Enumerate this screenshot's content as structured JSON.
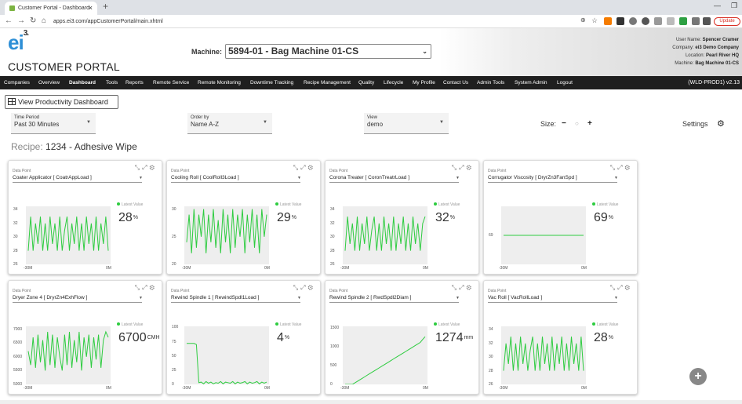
{
  "browser": {
    "tab_title": "Customer Portal - Dashboard",
    "url": "apps.ei3.com/appCustomerPortal/main.xhtml",
    "update_label": "Update"
  },
  "header": {
    "logo": "ei",
    "logo_sup": "3.",
    "portal_title": "CUSTOMER PORTAL",
    "machine_label": "Machine:",
    "machine_value": "5894-01 - Bag Machine 01-CS",
    "user_name_label": "User Name:",
    "user_name": "Spencer Cramer",
    "company_label": "Company:",
    "company": "ei3 Demo Company",
    "location_label": "Location:",
    "location": "Pearl River HQ",
    "machine_info_label": "Machine:",
    "machine_info": "Bag Machine 01-CS"
  },
  "menu": {
    "items": [
      "Companies",
      "Overview",
      "Dashboard",
      "Tools",
      "Reports",
      "Remote Service",
      "Remote Monitoring",
      "Downtime Tracking",
      "Recipe Management",
      "Quality",
      "Lifecycle",
      "My Profile",
      "Contact Us",
      "Admin Tools",
      "System Admin",
      "Logout"
    ],
    "active": "Dashboard",
    "env": "(WLD-PROD1) v2.13"
  },
  "toolbar": {
    "view_productivity": "View Productivity Dashboard",
    "time_period_label": "Time Period",
    "time_period_value": "Past 30 Minutes",
    "order_by_label": "Order by",
    "order_by_value": "Name A-Z",
    "view_label": "View",
    "view_value": "demo",
    "size_label": "Size:",
    "size_minus": "−",
    "size_plus": "+",
    "settings_label": "Settings"
  },
  "recipe": {
    "label": "Recipe:",
    "value": "1234 - Adhesive Wipe"
  },
  "cards": [
    {
      "dp_label": "Data Point",
      "dp_value": "Coater Applicator [ CoatrAppLoad ]",
      "latest_label": "Latest Value",
      "value": "28",
      "unit": "%"
    },
    {
      "dp_label": "Data Point",
      "dp_value": "Cooling Roll [ CoolRoll3Load ]",
      "latest_label": "Latest Value",
      "value": "29",
      "unit": "%"
    },
    {
      "dp_label": "Data Point",
      "dp_value": "Corona Treater [ CoronTreatrLoad ]",
      "latest_label": "Latest Value",
      "value": "32",
      "unit": "%"
    },
    {
      "dp_label": "Data Point",
      "dp_value": "Corrugator Viscosity [ DryrZn3FanSpd ]",
      "latest_label": "Latest Value",
      "value": "69",
      "unit": "%"
    },
    {
      "dp_label": "Data Point",
      "dp_value": "Dryer Zone 4 [ DryrZn4ExhFlow ]",
      "latest_label": "Latest Value",
      "value": "6700",
      "unit": "CMH"
    },
    {
      "dp_label": "Data Point",
      "dp_value": "Rewind Spindle 1 [ RewindSpdl1Load ]",
      "latest_label": "Latest Value",
      "value": "4",
      "unit": "%"
    },
    {
      "dp_label": "Data Point",
      "dp_value": "Rewind Spindle 2 [ RwdSpdl2Diam ]",
      "latest_label": "Latest Value",
      "value": "1274",
      "unit": "mm"
    },
    {
      "dp_label": "Data Point",
      "dp_value": "Vac Roll [ VacRollLoad ]",
      "latest_label": "Latest Value",
      "value": "28",
      "unit": "%"
    }
  ],
  "chart_data": [
    {
      "type": "line",
      "x_ticks": [
        "-30M",
        "0M"
      ],
      "y_ticks": [
        26,
        28,
        30,
        32,
        34
      ],
      "ylim": [
        26,
        34.5
      ],
      "color": "#2ecc40",
      "values": [
        28,
        33,
        28,
        32,
        29,
        33,
        28,
        32,
        28,
        33,
        29,
        32,
        28,
        33,
        28,
        31,
        33,
        28,
        32,
        29,
        33,
        28,
        32,
        28,
        33,
        29,
        32,
        28,
        33,
        28,
        32,
        29,
        33,
        28
      ]
    },
    {
      "type": "line",
      "x_ticks": [
        "-30M",
        "0M"
      ],
      "y_ticks": [
        20,
        25,
        30
      ],
      "ylim": [
        20,
        30.5
      ],
      "color": "#2ecc40",
      "values": [
        24,
        29,
        22,
        30,
        23,
        29,
        25,
        30,
        22,
        29,
        24,
        30,
        23,
        28,
        22,
        30,
        24,
        29,
        22,
        30,
        23,
        29,
        25,
        30,
        22,
        29,
        24,
        30,
        23,
        29,
        22,
        30,
        25,
        29
      ]
    },
    {
      "type": "line",
      "x_ticks": [
        "-30M",
        "0M"
      ],
      "y_ticks": [
        26,
        28,
        30,
        32,
        34
      ],
      "ylim": [
        26,
        34.5
      ],
      "color": "#2ecc40",
      "values": [
        28,
        33,
        29,
        32,
        28,
        33,
        28,
        32,
        29,
        33,
        28,
        31,
        33,
        28,
        32,
        28,
        33,
        29,
        32,
        28,
        33,
        28,
        32,
        29,
        33,
        28,
        32,
        28,
        33,
        29,
        32,
        28,
        32,
        33
      ]
    },
    {
      "type": "line",
      "x_ticks": [
        "-30M",
        "0M"
      ],
      "y_ticks": [
        69
      ],
      "ylim": [
        63,
        75
      ],
      "color": "#2ecc40",
      "values": [
        69,
        69,
        69,
        69,
        69,
        69,
        69,
        69,
        69,
        69,
        69,
        69,
        69,
        69,
        69,
        69,
        69,
        69,
        69,
        69,
        69,
        69,
        69,
        69,
        69,
        69,
        69,
        69,
        69,
        69,
        69,
        69,
        69,
        69
      ]
    },
    {
      "type": "line",
      "x_ticks": [
        "-30M",
        "0M"
      ],
      "y_ticks": [
        5000,
        5500,
        6000,
        6500,
        7000
      ],
      "ylim": [
        5000,
        7100
      ],
      "color": "#2ecc40",
      "values": [
        6200,
        5700,
        6700,
        5600,
        6800,
        5800,
        6600,
        5500,
        6900,
        5700,
        6800,
        5600,
        6700,
        6000,
        5500,
        6800,
        5700,
        6900,
        5600,
        6600,
        5800,
        6900,
        5500,
        6700,
        6000,
        6800,
        5600,
        6700,
        5900,
        6800,
        5600,
        6600,
        6900,
        6700
      ]
    },
    {
      "type": "line",
      "x_ticks": [
        "-30M",
        "0M"
      ],
      "y_ticks": [
        0,
        25,
        50,
        75,
        100
      ],
      "ylim": [
        0,
        102
      ],
      "color": "#2ecc40",
      "values": [
        72,
        72,
        72,
        72,
        70,
        3,
        4,
        1,
        5,
        2,
        4,
        1,
        3,
        2,
        5,
        1,
        4,
        3,
        2,
        5,
        1,
        4,
        2,
        3,
        5,
        1,
        4,
        2,
        3,
        5,
        1,
        4,
        2,
        4
      ]
    },
    {
      "type": "line",
      "x_ticks": [
        "-30M",
        "0M"
      ],
      "y_ticks": [
        0,
        500,
        1000,
        1500
      ],
      "ylim": [
        0,
        1550
      ],
      "color": "#2ecc40",
      "values": [
        0,
        0,
        0,
        0,
        40,
        80,
        120,
        160,
        200,
        240,
        280,
        320,
        360,
        400,
        440,
        480,
        520,
        560,
        600,
        640,
        680,
        720,
        760,
        800,
        840,
        880,
        920,
        960,
        1000,
        1040,
        1080,
        1120,
        1200,
        1274
      ]
    },
    {
      "type": "line",
      "x_ticks": [
        "-30M",
        "0M"
      ],
      "y_ticks": [
        26,
        28,
        30,
        32,
        34
      ],
      "ylim": [
        26,
        34.5
      ],
      "color": "#2ecc40",
      "values": [
        28,
        32,
        29,
        33,
        28,
        32,
        28,
        33,
        29,
        32,
        28,
        31,
        33,
        28,
        32,
        28,
        33,
        29,
        32,
        28,
        33,
        28,
        32,
        29,
        33,
        28,
        32,
        28,
        33,
        29,
        32,
        28,
        33,
        28
      ]
    }
  ]
}
